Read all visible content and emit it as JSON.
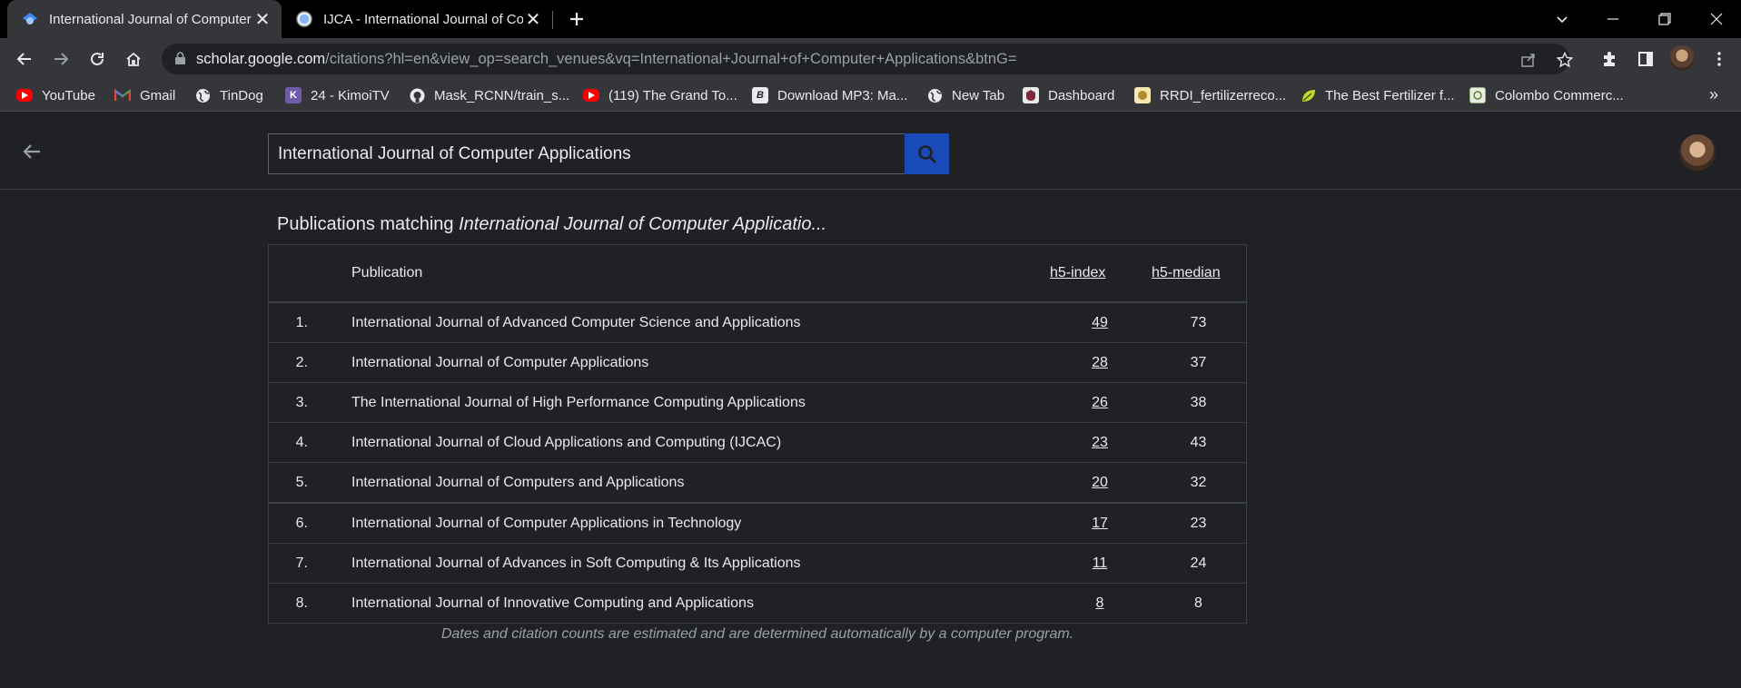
{
  "browser": {
    "tabs": [
      {
        "title": "International Journal of Computer Applications",
        "active": true
      },
      {
        "title": "IJCA - International Journal of Computer Applications",
        "active": false
      }
    ],
    "new_tab_icon": "plus-icon",
    "address": {
      "host": "scholar.google.com",
      "path": "/citations?hl=en&view_op=search_venues&vq=International+Journal+of+Computer+Applications&btnG="
    },
    "bookmarks": [
      {
        "label": "YouTube",
        "icon": "youtube-icon"
      },
      {
        "label": "Gmail",
        "icon": "gmail-icon"
      },
      {
        "label": "TinDog",
        "icon": "globe-icon"
      },
      {
        "label": "24 - KimoiTV",
        "icon": "kimoi-icon"
      },
      {
        "label": "Mask_RCNN/train_s...",
        "icon": "github-icon"
      },
      {
        "label": "(119) The Grand To...",
        "icon": "youtube-icon"
      },
      {
        "label": "Download MP3: Ma...",
        "icon": "b-icon"
      },
      {
        "label": "New Tab",
        "icon": "globe-icon"
      },
      {
        "label": "Dashboard",
        "icon": "dashboard-icon"
      },
      {
        "label": "RRDI_fertilizerreco...",
        "icon": "rrdi-icon"
      },
      {
        "label": "The Best Fertilizer f...",
        "icon": "leaf-icon"
      },
      {
        "label": "Colombo Commerc...",
        "icon": "colombo-icon"
      }
    ],
    "bookmarks_more": "»"
  },
  "scholar": {
    "search_value": "International Journal of Computer Applications",
    "heading_prefix": "Publications matching ",
    "heading_query": "International Journal of Computer Applicatio...",
    "columns": {
      "publication": "Publication",
      "h5_index": "h5-index",
      "h5_median": "h5-median"
    },
    "rows": [
      {
        "rank": "1.",
        "name": "International Journal of Advanced Computer Science and Applications",
        "h5_index": "49",
        "h5_median": "73"
      },
      {
        "rank": "2.",
        "name": "International Journal of Computer Applications",
        "h5_index": "28",
        "h5_median": "37"
      },
      {
        "rank": "3.",
        "name": "The International Journal of High Performance Computing Applications",
        "h5_index": "26",
        "h5_median": "38"
      },
      {
        "rank": "4.",
        "name": "International Journal of Cloud Applications and Computing (IJCAC)",
        "h5_index": "23",
        "h5_median": "43"
      },
      {
        "rank": "5.",
        "name": "International Journal of Computers and Applications",
        "h5_index": "20",
        "h5_median": "32"
      },
      {
        "rank": "6.",
        "name": "International Journal of Computer Applications in Technology",
        "h5_index": "17",
        "h5_median": "23"
      },
      {
        "rank": "7.",
        "name": "International Journal of Advances in Soft Computing & Its Applications",
        "h5_index": "11",
        "h5_median": "24"
      },
      {
        "rank": "8.",
        "name": "International Journal of Innovative Computing and Applications",
        "h5_index": "8",
        "h5_median": "8"
      }
    ],
    "disclaimer": "Dates and citation counts are estimated and are determined automatically by a computer program."
  },
  "colors": {
    "accent": "#1a4ab8",
    "page_bg": "#202124",
    "toolbar_bg": "#35363a"
  }
}
